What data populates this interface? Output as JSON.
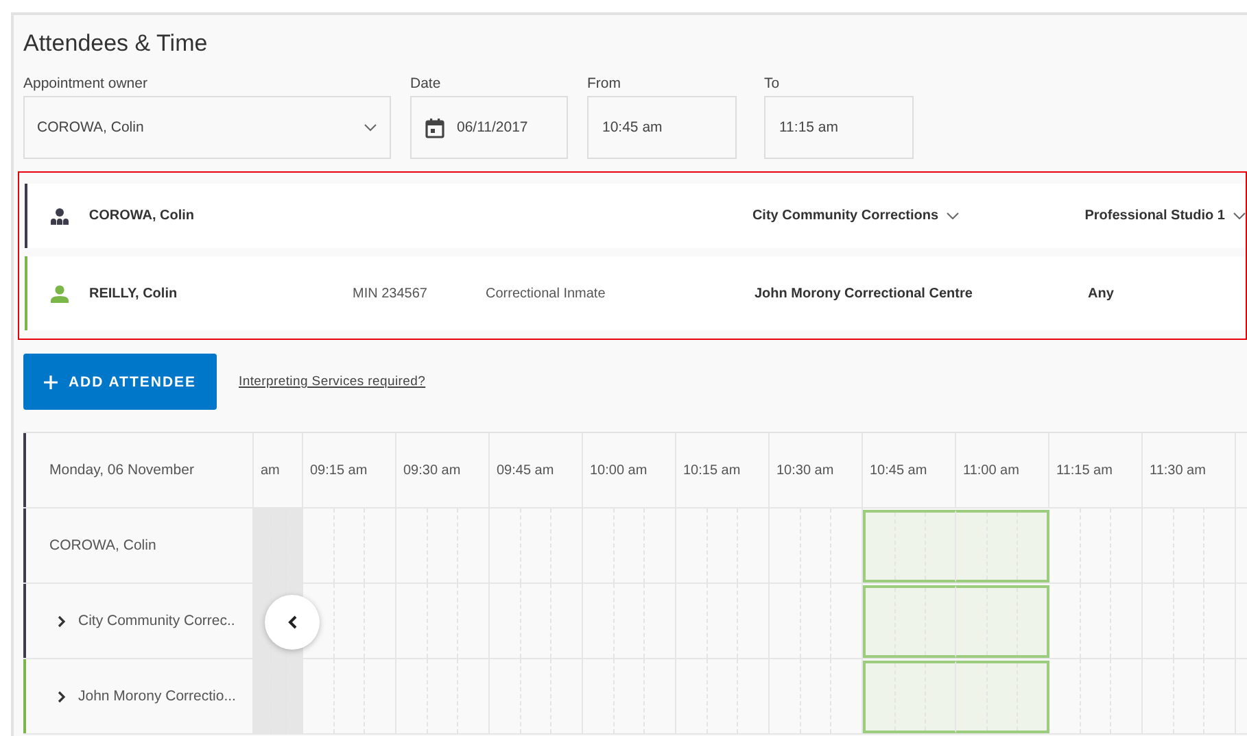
{
  "title": "Attendees & Time",
  "fields": {
    "owner": {
      "label": "Appointment owner",
      "value": "COROWA, Colin"
    },
    "date": {
      "label": "Date",
      "value": "06/11/2017"
    },
    "from": {
      "label": "From",
      "value": "10:45 am"
    },
    "to": {
      "label": "To",
      "value": "11:15 am"
    }
  },
  "attendees": [
    {
      "kind": "group",
      "name": "COROWA, Colin",
      "color": "#3c3c4c",
      "location": "City Community Corrections",
      "location_dropdown": true,
      "room": "Professional Studio 1",
      "room_dropdown": true
    },
    {
      "kind": "person",
      "name": "REILLY, Colin",
      "color": "#7ab648",
      "id_number": "MIN 234567",
      "role": "Correctional Inmate",
      "location": "John Morony Correctional Centre",
      "location_dropdown": false,
      "room": "Any",
      "room_dropdown": false
    }
  ],
  "add_button": "ADD ATTENDEE",
  "interpreting_link": "Interpreting Services required?",
  "schedule": {
    "date_heading": "Monday, 06 November",
    "columns": [
      {
        "label": "am",
        "selected": false,
        "unavailable": true
      },
      {
        "label": "09:15 am",
        "selected": false,
        "unavailable": false
      },
      {
        "label": "09:30 am",
        "selected": false,
        "unavailable": false
      },
      {
        "label": "09:45 am",
        "selected": false,
        "unavailable": false
      },
      {
        "label": "10:00 am",
        "selected": false,
        "unavailable": false
      },
      {
        "label": "10:15 am",
        "selected": false,
        "unavailable": false
      },
      {
        "label": "10:30 am",
        "selected": false,
        "unavailable": false
      },
      {
        "label": "10:45 am",
        "selected": true,
        "unavailable": false
      },
      {
        "label": "11:00 am",
        "selected": true,
        "unavailable": false
      },
      {
        "label": "11:15 am",
        "selected": false,
        "unavailable": false
      },
      {
        "label": "11:30 am",
        "selected": false,
        "unavailable": false
      }
    ],
    "rows": [
      {
        "kind": "person",
        "label": "COROWA, Colin",
        "color": "#3c3c4c"
      },
      {
        "kind": "location",
        "label": "City Community Correc..",
        "color": "#3c3c4c",
        "expanded": false
      },
      {
        "kind": "location",
        "label": "John Morony Correctio...",
        "color": "#7ab648",
        "expanded": false
      }
    ]
  }
}
